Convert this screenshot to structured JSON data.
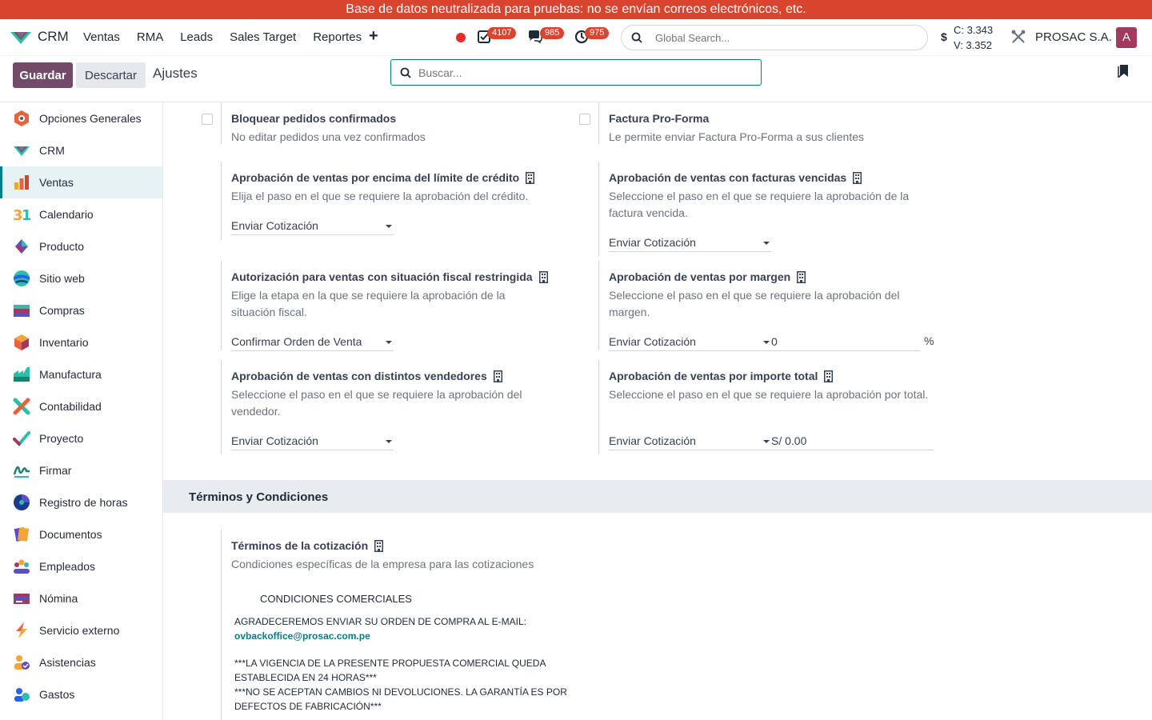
{
  "banner": {
    "text": "Base de datos neutralizada para pruebas: no se envían correos electrónicos, etc."
  },
  "navbar": {
    "app_name": "CRM",
    "menu": [
      "Ventas",
      "RMA",
      "Leads",
      "Sales Target",
      "Reportes"
    ],
    "activity_count": "4107",
    "message_count": "985",
    "timer_count": "975",
    "global_search_placeholder": "Global Search...",
    "currency_symbol": "$",
    "rate_c": "C: 3.343",
    "rate_v": "V: 3.352",
    "company": "PROSAC S.A.",
    "avatar_letter": "A",
    "accent": "#714b67",
    "banner_color": "#d9442f"
  },
  "control": {
    "save_label": "Guardar",
    "discard_label": "Descartar",
    "breadcrumb": "Ajustes",
    "search_placeholder": "Buscar..."
  },
  "sidebar": {
    "items": [
      {
        "label": "Opciones Generales",
        "icon": "settings-app-icon"
      },
      {
        "label": "CRM",
        "icon": "crm-app-icon"
      },
      {
        "label": "Ventas",
        "icon": "sales-app-icon",
        "active": true
      },
      {
        "label": "Calendario",
        "icon": "calendar-app-icon"
      },
      {
        "label": "Producto",
        "icon": "product-app-icon"
      },
      {
        "label": "Sitio web",
        "icon": "website-app-icon"
      },
      {
        "label": "Compras",
        "icon": "purchase-app-icon"
      },
      {
        "label": "Inventario",
        "icon": "inventory-app-icon"
      },
      {
        "label": "Manufactura",
        "icon": "manufacturing-app-icon"
      },
      {
        "label": "Contabilidad",
        "icon": "accounting-app-icon"
      },
      {
        "label": "Proyecto",
        "icon": "project-app-icon"
      },
      {
        "label": "Firmar",
        "icon": "sign-app-icon"
      },
      {
        "label": "Registro de horas",
        "icon": "timesheet-app-icon"
      },
      {
        "label": "Documentos",
        "icon": "documents-app-icon"
      },
      {
        "label": "Empleados",
        "icon": "employees-app-icon"
      },
      {
        "label": "Nómina",
        "icon": "payroll-app-icon"
      },
      {
        "label": "Servicio externo",
        "icon": "field-service-app-icon"
      },
      {
        "label": "Asistencias",
        "icon": "attendance-app-icon"
      },
      {
        "label": "Gastos",
        "icon": "expenses-app-icon"
      }
    ]
  },
  "settings": {
    "lock_orders": {
      "title": "Bloquear pedidos confirmados",
      "desc": "No editar pedidos una vez confirmados"
    },
    "proforma": {
      "title": "Factura Pro-Forma",
      "desc": "Le permite enviar Factura Pro-Forma a sus clientes"
    },
    "credit_limit": {
      "title": "Aprobación de ventas por encima del límite de crédito",
      "desc": "Elija el paso en el que se requiere la aprobación del crédito.",
      "value": "Enviar Cotización"
    },
    "overdue": {
      "title": "Aprobación de ventas con facturas vencidas",
      "desc": "Seleccione el paso en el que se requiere la aprobación de la factura vencida.",
      "value": "Enviar Cotización"
    },
    "fiscal": {
      "title": "Autorización para ventas con situación fiscal restringida",
      "desc": "Elige la etapa en la que se requiere la aprobación de la situación fiscal.",
      "value": "Confirmar Orden de Venta"
    },
    "margin": {
      "title": "Aprobación de ventas por margen",
      "desc": "Seleccione el paso en el que se requiere la aprobación del margen.",
      "value": "Enviar Cotización",
      "amount": "0",
      "unit": "%"
    },
    "salesperson": {
      "title": "Aprobación de ventas con distintos vendedores",
      "desc": "Seleccione el paso en el que se requiere la aprobación del vendedor.",
      "value": "Enviar Cotización"
    },
    "total": {
      "title": "Aprobación de ventas por importe total",
      "desc": "Seleccione el paso en el que se requiere la aprobación por total.",
      "value": "Enviar Cotización",
      "amount": "S/ 0.00"
    }
  },
  "terms": {
    "section_title": "Términos y Condiciones",
    "title": "Términos de la cotización",
    "desc": "Condiciones específicas de la empresa para las cotizaciones",
    "heading": "CONDICIONES COMERCIALES",
    "line1": "AGRADECEREMOS ENVIAR SU ORDEN DE COMPRA AL E-MAIL:",
    "email": "ovbackoffice@prosac.com.pe",
    "line2": "***LA VIGENCIA DE LA PRESENTE PROPUESTA COMERCIAL QUEDA ESTABLECIDA EN 24 HORAS***",
    "line3": "***NO SE ACEPTAN CAMBIOS NI DEVOLUCIONES. LA GARANTÍA ES POR DEFECTOS DE FABRICACIÓN***"
  }
}
